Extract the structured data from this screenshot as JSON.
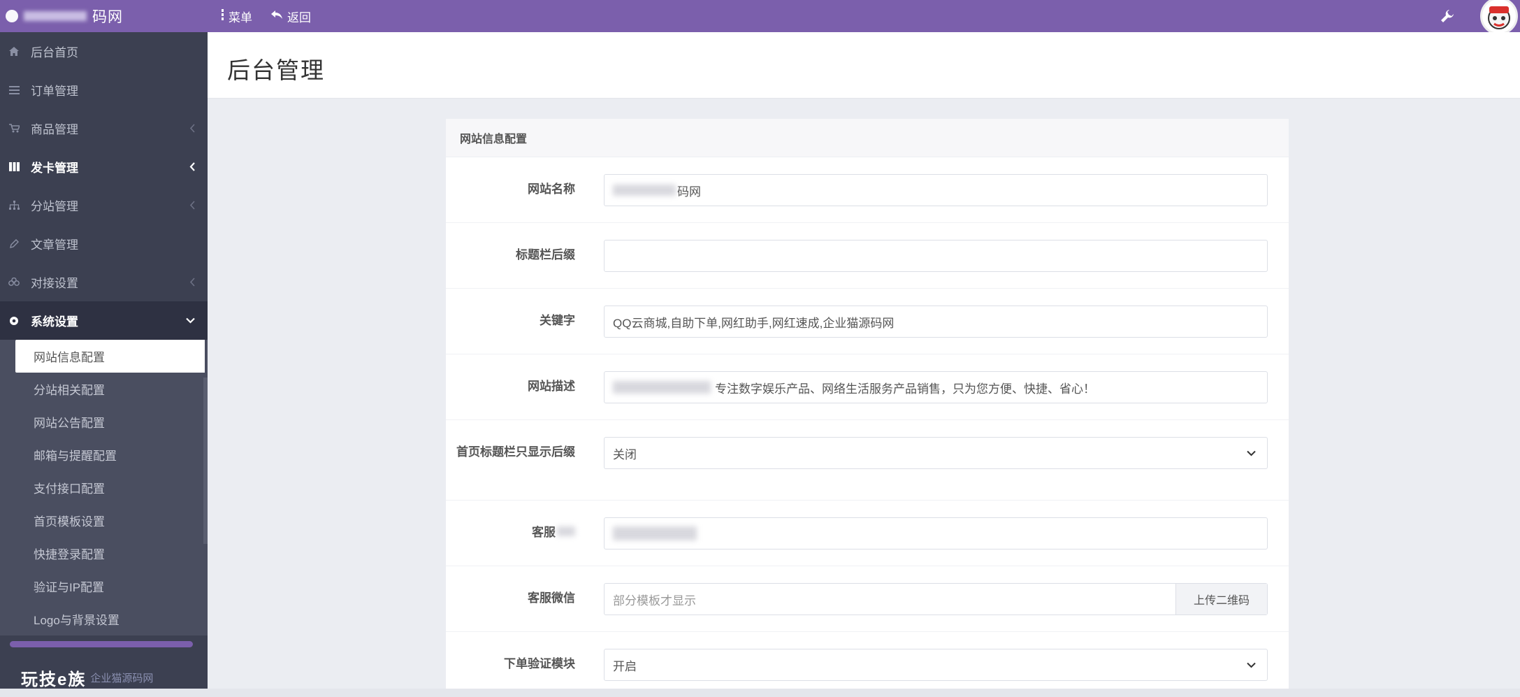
{
  "topbar": {
    "brand_text": "码网",
    "menu_label": "菜单",
    "back_label": "返回"
  },
  "sidebar": {
    "items": [
      {
        "label": "后台首页",
        "icon": "home-icon"
      },
      {
        "label": "订单管理",
        "icon": "list-icon"
      },
      {
        "label": "商品管理",
        "icon": "cart-icon"
      },
      {
        "label": "发卡管理",
        "icon": "grid-icon"
      },
      {
        "label": "分站管理",
        "icon": "sitemap-icon"
      },
      {
        "label": "文章管理",
        "icon": "edit-icon"
      },
      {
        "label": "对接设置",
        "icon": "link-icon"
      },
      {
        "label": "系统设置",
        "icon": "gear-icon"
      }
    ],
    "submenu": [
      "网站信息配置",
      "分站相关配置",
      "网站公告配置",
      "邮箱与提醒配置",
      "支付接口配置",
      "首页模板设置",
      "快捷登录配置",
      "验证与IP配置",
      "Logo与背景设置"
    ],
    "footer_watermark": "玩技e族",
    "footer_text": "企业猫源码网"
  },
  "header": {
    "title": "后台管理"
  },
  "panel": {
    "title": "网站信息配置",
    "fields": {
      "site_name": {
        "label": "网站名称",
        "value": "码网"
      },
      "title_suffix": {
        "label": "标题栏后缀",
        "value": ""
      },
      "keywords": {
        "label": "关键字",
        "value": "QQ云商城,自助下单,网红助手,网红速成,企业猫源码网"
      },
      "description": {
        "label": "网站描述",
        "value": "专注数字娱乐产品、网络生活服务产品销售，只为您方便、快捷、省心！"
      },
      "home_title_only_suffix": {
        "label": "首页标题栏只显示后缀",
        "value": "关闭"
      },
      "service_qq": {
        "label": "客服",
        "value": ""
      },
      "service_wechat": {
        "label": "客服微信",
        "placeholder": "部分模板才显示",
        "button": "上传二维码"
      },
      "order_captcha": {
        "label": "下单验证模块",
        "value": "开启"
      }
    }
  },
  "colors": {
    "brand": "#7b5fac",
    "sidebar": "#3c4051",
    "background": "#ebedf2"
  }
}
